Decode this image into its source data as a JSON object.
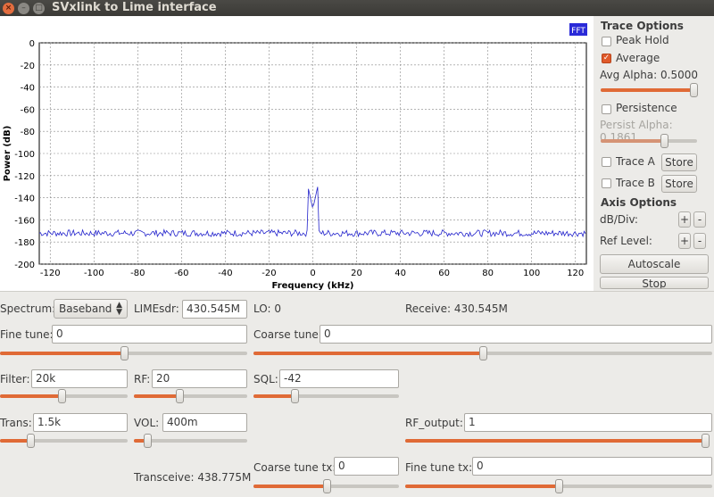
{
  "window": {
    "title": "SVxlink to Lime interface",
    "close_glyph": "×",
    "minimize_glyph": "–",
    "maximize_glyph": "□"
  },
  "chart_data": {
    "type": "line",
    "badge": "FFT",
    "xlabel": "Frequency (kHz)",
    "ylabel": "Power (dB)",
    "xlim": [
      -125,
      125
    ],
    "ylim": [
      -200,
      0
    ],
    "xticks": [
      -120,
      -100,
      -80,
      -60,
      -40,
      -20,
      0,
      20,
      40,
      60,
      80,
      100,
      120
    ],
    "yticks": [
      0,
      -20,
      -40,
      -60,
      -80,
      -100,
      -120,
      -140,
      -160,
      -180,
      -200
    ],
    "grid": true,
    "line_color": "#2222cc",
    "noise_floor_db": -172,
    "noise_amplitude_db": 3,
    "peak": {
      "x": 0,
      "y": -150
    }
  },
  "trace_options": {
    "heading": "Trace Options",
    "peak_hold": {
      "label": "Peak Hold",
      "checked": false
    },
    "average": {
      "label": "Average",
      "checked": true
    },
    "avg_alpha_label": "Avg Alpha: 0.5000",
    "avg_alpha_value": 0.96,
    "persistence": {
      "label": "Persistence",
      "checked": false
    },
    "persist_alpha_label": "Persist Alpha: 0.1861",
    "persist_alpha_value": 0.66,
    "trace_a": {
      "label": "Trace A",
      "checked": false,
      "button": "Store"
    },
    "trace_b": {
      "label": "Trace B",
      "checked": false,
      "button": "Store"
    }
  },
  "axis_options": {
    "heading": "Axis Options",
    "db_div_label": "dB/Div:",
    "ref_level_label": "Ref Level:",
    "plus": "+",
    "minus": "-",
    "autoscale": "Autoscale",
    "stop": "Stop"
  },
  "controls": {
    "spectrum_label": "Spectrum:",
    "spectrum_value": "Baseband",
    "limesdr_label": "LIMEsdr:",
    "limesdr_value": "430.545M",
    "lo_text": "LO: 0",
    "receive_text": "Receive: 430.545M",
    "fine_tune_label": "Fine tune:",
    "fine_tune_value": "0",
    "fine_tune_slider": 0.5,
    "coarse_tune_label": "Coarse tune:",
    "coarse_tune_value": "0",
    "coarse_tune_slider": 0.5,
    "filter_label": "Filter:",
    "filter_value": "20k",
    "filter_slider": 0.48,
    "rf_label": "RF:",
    "rf_value": "20",
    "rf_slider": 0.4,
    "sql_label": "SQL:",
    "sql_value": "-42",
    "sql_slider": 0.28,
    "trans_label": "Trans:",
    "trans_value": "1.5k",
    "trans_slider": 0.24,
    "vol_label": "VOL:",
    "vol_value": "400m",
    "vol_slider": 0.12,
    "rf_output_label": "RF_output:",
    "rf_output_value": "1",
    "rf_output_slider": 1.0,
    "transceive_text": "Transceive: 438.775M",
    "coarse_tune_tx_label": "Coarse tune tx:",
    "coarse_tune_tx_value": "0",
    "coarse_tune_tx_slider": 0.5,
    "fine_tune_tx_label": "Fine tune tx:",
    "fine_tune_tx_value": "0",
    "fine_tune_tx_slider": 0.5
  }
}
